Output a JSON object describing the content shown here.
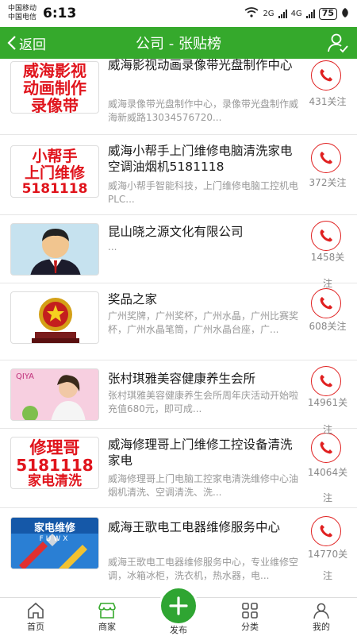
{
  "status": {
    "carrier1": "中国移动",
    "carrier2": "中国电信",
    "time": "6:13",
    "net1": "2G",
    "net2": "4G",
    "battery": "75"
  },
  "nav": {
    "back_label": "返回",
    "title": "公司 - 张贴榜"
  },
  "accent_color": "#35a92c",
  "items": [
    {
      "name": "威海影视动画录像带光盘制作中心",
      "desc": "威海录像带光盘制作中心，录像带光盘制作威海新威路13034576720...",
      "follow": "431关注",
      "thumb_text": [
        "威海影视",
        "动画制作",
        "录像带"
      ]
    },
    {
      "name": "威海小帮手上门维修电脑清洗家电空调油烟机5181118",
      "desc": "威海小帮手智能科技，上门维修电脑工控机电PLC...",
      "follow": "372关注",
      "thumb_text": [
        "小帮手",
        "上门维修",
        "5181118"
      ]
    },
    {
      "name": "昆山晓之源文化有限公司",
      "desc": "...",
      "follow": "1458关",
      "follow2": "注",
      "thumb_text": []
    },
    {
      "name": "奖品之家",
      "desc": "广州奖牌，广州奖杯，广州水晶，广州比赛奖杯，广州水晶笔筒，广州水晶台座，广...",
      "follow": "608关注",
      "thumb_text": []
    },
    {
      "name": "张村琪雅美容健康养生会所",
      "desc": "张村琪雅美容健康养生会所周年庆活动开始啦　　　充值680元，即可成...",
      "follow": "14961关",
      "follow2": "注",
      "thumb_text": [
        "QIYA"
      ]
    },
    {
      "name": "威海修理哥上门维修工控设备清洗家电",
      "desc": "威海修理哥上门电脑工控家电清洗维修中心油烟机清洗、空调清洗、洗...",
      "follow": "14064关",
      "follow2": "注",
      "thumb_text": [
        "修理哥",
        "5181118",
        "家电清洗"
      ]
    },
    {
      "name": "威海王歌电工电器维修服务中心",
      "desc": "威海王歌电工电器维修服务中心，专业维修空调，冰箱冰柜，洗衣机，热水器，电...",
      "follow": "14770关",
      "follow2": "注",
      "thumb_text": [
        "家电维修",
        "FUWX"
      ]
    }
  ],
  "tabs": {
    "home": "首页",
    "merchant": "商家",
    "publish": "发布",
    "category": "分类",
    "mine": "我的"
  }
}
